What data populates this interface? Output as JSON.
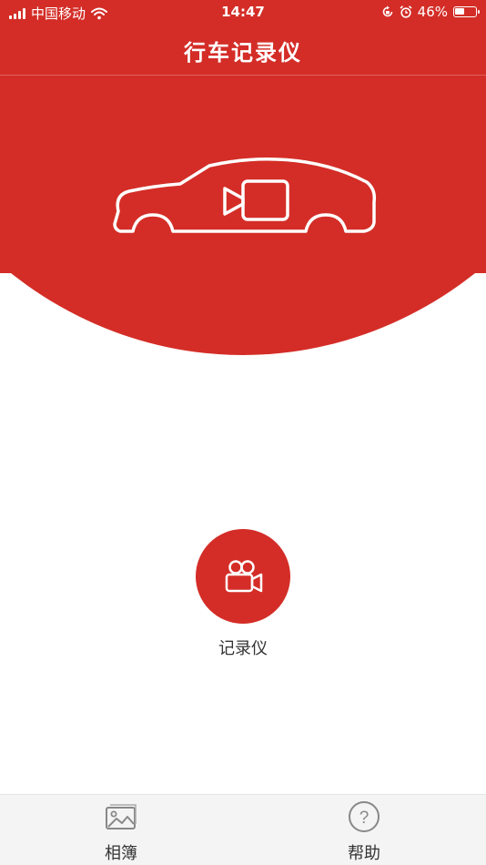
{
  "status_bar": {
    "carrier": "中国移动",
    "time": "14:47",
    "battery": "46%",
    "battery_level": 0.46
  },
  "header": {
    "title": "行车记录仪"
  },
  "main": {
    "record_button": {
      "icon": "video-camera-icon",
      "label": "记录仪"
    }
  },
  "tab_bar": {
    "items": [
      {
        "label": "相簿",
        "icon": "image-icon"
      },
      {
        "label": "帮助",
        "icon": "help-icon"
      }
    ]
  },
  "colors": {
    "primary": "#d42d27",
    "tab_bar_bg": "#f4f4f4",
    "text": "#333333"
  }
}
